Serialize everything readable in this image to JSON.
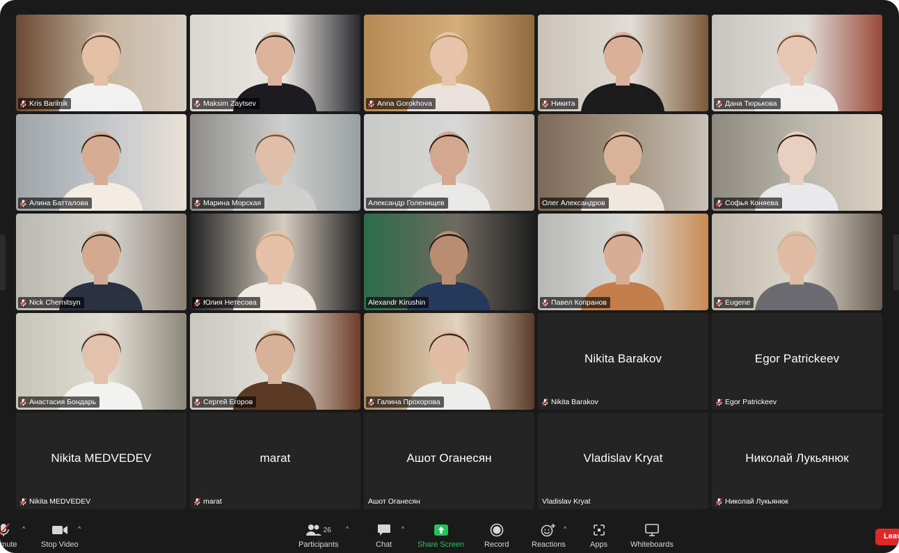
{
  "participants": [
    {
      "name": "Kris Barilnik",
      "video": true,
      "muted": true
    },
    {
      "name": "Maksim Zaytsev",
      "video": true,
      "muted": true
    },
    {
      "name": "Anna Gorokhova",
      "video": true,
      "muted": true
    },
    {
      "name": "Никита",
      "video": true,
      "muted": true
    },
    {
      "name": "Дана Тюрькова",
      "video": true,
      "muted": true
    },
    {
      "name": "Алина Батталова",
      "video": true,
      "muted": true
    },
    {
      "name": "Марина Морская",
      "video": true,
      "muted": true
    },
    {
      "name": "Александр Голенищев",
      "video": true,
      "muted": false
    },
    {
      "name": "Олег Александров",
      "video": true,
      "muted": false
    },
    {
      "name": "Софья Коняева",
      "video": true,
      "muted": true
    },
    {
      "name": "Nick Chernitsyn",
      "video": true,
      "muted": true
    },
    {
      "name": "Юлия Нетесова",
      "video": true,
      "muted": true
    },
    {
      "name": "Alexandr Kirushin",
      "video": true,
      "muted": false
    },
    {
      "name": "Павел Копранов",
      "video": true,
      "muted": true
    },
    {
      "name": "Eugene",
      "video": true,
      "muted": true
    },
    {
      "name": "Анастасия Бондарь",
      "video": true,
      "muted": true
    },
    {
      "name": "Сергей Егоров",
      "video": true,
      "muted": true
    },
    {
      "name": "Галина Прохорова",
      "video": true,
      "muted": true
    },
    {
      "name": "Nikita Barakov",
      "video": false,
      "muted": true
    },
    {
      "name": "Egor Patrickeev",
      "video": false,
      "muted": true
    },
    {
      "name": "Nikita MEDVEDEV",
      "video": false,
      "muted": true
    },
    {
      "name": "marat",
      "video": false,
      "muted": true
    },
    {
      "name": "Ашот Оганесян",
      "video": false,
      "muted": false
    },
    {
      "name": "Vladislav Kryat",
      "video": false,
      "muted": false
    },
    {
      "name": "Николай Лукьянюк",
      "video": false,
      "muted": true
    }
  ],
  "toolbar": {
    "mute_label": "Unmute",
    "video_label": "Stop Video",
    "participants_label": "Participants",
    "participants_count": "26",
    "chat_label": "Chat",
    "share_label": "Share Screen",
    "record_label": "Record",
    "reactions_label": "Reactions",
    "apps_label": "Apps",
    "whiteboards_label": "Whiteboards",
    "leave_label": "Leave"
  },
  "colors": {
    "accent_green": "#22c35b",
    "leave_red": "#e02828",
    "mic_muted_red": "#e0342b"
  }
}
